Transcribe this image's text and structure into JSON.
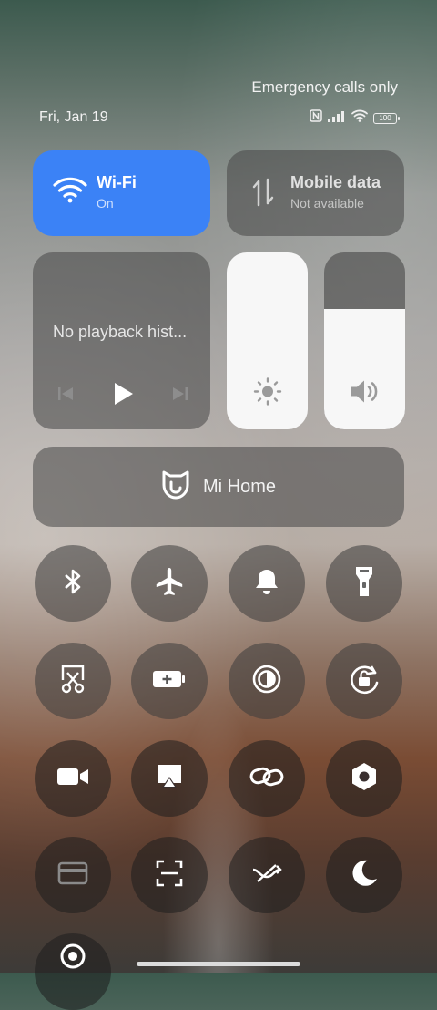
{
  "status_bar": {
    "carrier_text": "Emergency calls only",
    "date": "Fri, Jan 19",
    "battery": "100"
  },
  "tiles": {
    "wifi": {
      "title": "Wi-Fi",
      "status": "On",
      "color": "#3b82f6"
    },
    "mobile_data": {
      "title": "Mobile data",
      "status": "Not available"
    }
  },
  "media": {
    "text": "No playback hist..."
  },
  "sliders": {
    "brightness_level": 1.0,
    "volume_level": 0.68
  },
  "mi_home": {
    "label": "Mi Home"
  },
  "toggles": [
    "bluetooth-icon",
    "airplane-icon",
    "bell-icon",
    "flashlight-icon",
    "screenshot-scissors-icon",
    "battery-saver-icon",
    "contrast-icon",
    "rotation-lock-icon",
    "video-camera-icon",
    "cast-icon",
    "link-icon",
    "settings-hex-icon",
    "card-icon",
    "scan-icon",
    "shuffle-icon",
    "moon-icon",
    "location-icon"
  ]
}
